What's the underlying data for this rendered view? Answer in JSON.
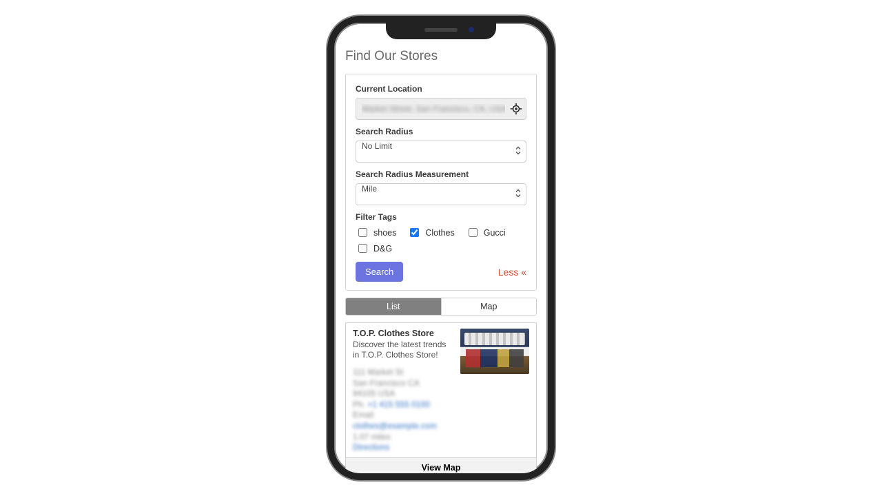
{
  "page": {
    "title": "Find Our Stores"
  },
  "form": {
    "location_label": "Current Location",
    "location_value": "Market Street, San Francisco, CA, USA",
    "radius_label": "Search Radius",
    "radius_value": "No Limit",
    "radius_unit_label": "Search Radius Measurement",
    "radius_unit_value": "Mile",
    "filter_label": "Filter Tags",
    "tags": [
      {
        "label": "shoes",
        "checked": false
      },
      {
        "label": "Clothes",
        "checked": true
      },
      {
        "label": "Gucci",
        "checked": false
      },
      {
        "label": "D&G",
        "checked": false
      }
    ],
    "search_button": "Search",
    "less_link": "Less «"
  },
  "view_toggle": {
    "list": "List",
    "map": "Map",
    "active": "list"
  },
  "result": {
    "name": "T.O.P. Clothes Store",
    "desc": "Discover the latest trends in T.O.P. Clothes Store!",
    "address_line1": "111 Market St",
    "address_line2": "San Francisco CA",
    "address_line3": "94105 USA",
    "phone_label": "Ph.",
    "phone_value": "+1 415 555 0100",
    "email_label": "Email",
    "email_value": "clothes@example.com",
    "distance": "1.07 miles",
    "directions": "Directions",
    "view_map": "View Map"
  },
  "icons": {
    "locate": "locate-icon",
    "caret": "▴▾"
  }
}
